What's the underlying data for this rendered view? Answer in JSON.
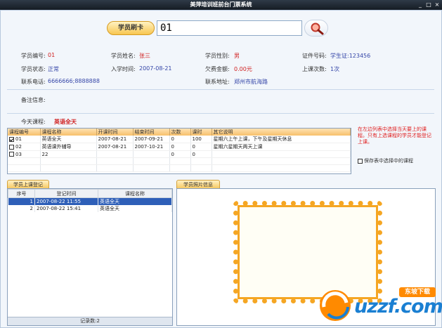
{
  "window": {
    "title": "美萍培训班前台门票系统",
    "min": "_",
    "max": "□",
    "close": "×"
  },
  "card": {
    "button_label": "学员刷卡",
    "input_value": "01"
  },
  "info": {
    "student_id_label": "学员编号:",
    "student_id": "01",
    "name_label": "学员姓名:",
    "name": "张三",
    "gender_label": "学员性别:",
    "gender": "男",
    "cert_label": "证件号码:",
    "cert": "学生证:123456",
    "status_label": "学员状态:",
    "status": "正常",
    "enroll_label": "入学时间:",
    "enroll": "2007-08-21",
    "owe_label": "欠费金额:",
    "owe": "0.00元",
    "count_label": "上课次数:",
    "count": "1次",
    "phone_label": "联系电话:",
    "phone": "6666666;8888888",
    "addr_label": "联系地址:",
    "addr": "郑州市航海路",
    "remark_label": "备注信息:"
  },
  "today": {
    "label": "今天课程:",
    "value": "英语全天"
  },
  "course_table": {
    "headers": [
      "课程编号",
      "课程名称",
      "开课时间",
      "结束时间",
      "次数",
      "课时",
      "其它说明"
    ],
    "rows": [
      {
        "checked": true,
        "id": "01",
        "name": "英语全天",
        "start": "2007-08-21",
        "end": "2007-09-21",
        "times": "0",
        "hours": "100",
        "note": "星期六上午上课，下午及星期天休息"
      },
      {
        "checked": false,
        "id": "02",
        "name": "英语课外辅导",
        "start": "2007-08-21",
        "end": "2007-10-21",
        "times": "0",
        "hours": "0",
        "note": "星期六星期天两天上课"
      },
      {
        "checked": false,
        "id": "03",
        "name": "22",
        "start": "",
        "end": "",
        "times": "0",
        "hours": "0",
        "note": ""
      }
    ]
  },
  "hint": "在左边列表中选择当天要上的课程。只有上选课程的学员才能登记上课。",
  "save_checkbox_label": "保存表中选择中的课程",
  "reg": {
    "tab": "学员上课登记",
    "headers": [
      "序号",
      "登记时间",
      "课程名称"
    ],
    "rows": [
      {
        "no": "1",
        "time": "2007-08-22 11:55",
        "course": "英语全天",
        "selected": true
      },
      {
        "no": "2",
        "time": "2007-08-22 15:41",
        "course": "英语全天",
        "selected": false
      }
    ],
    "footer": "记录数:2"
  },
  "photo": {
    "tab": "学员照片信息"
  },
  "watermark": {
    "text": "uzzf.com",
    "badge": "东坡下载"
  },
  "colors": {
    "accent_orange": "#f5a623",
    "label_blue": "#3546a8",
    "value_red": "#d02020"
  }
}
